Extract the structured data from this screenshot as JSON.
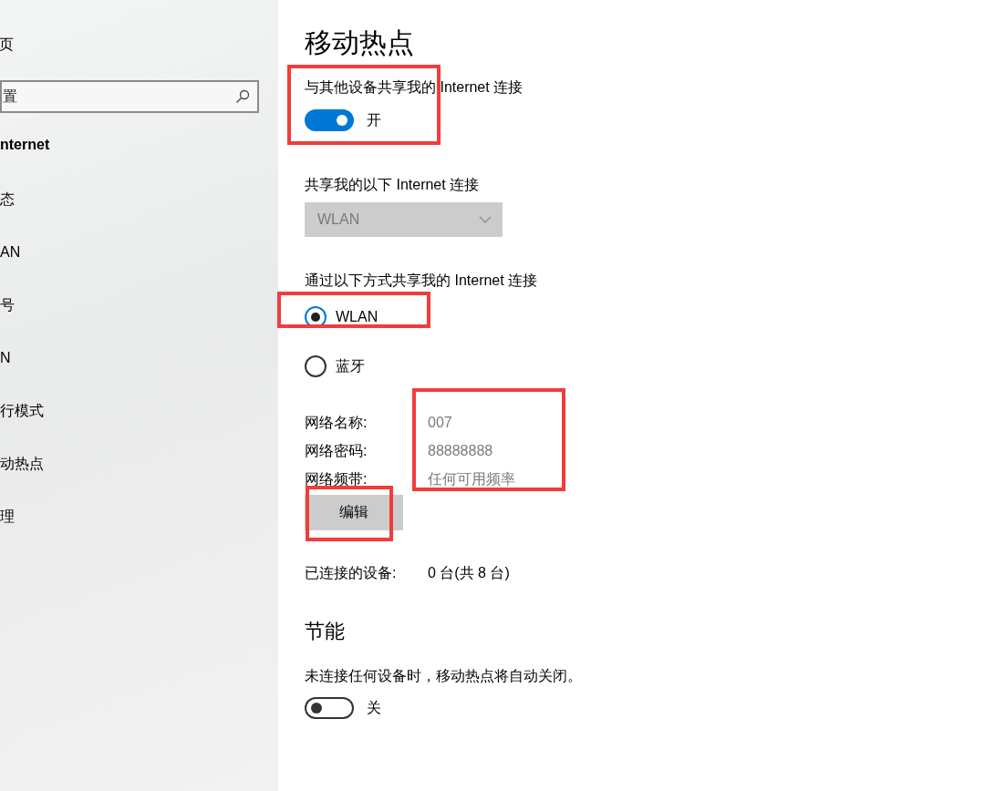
{
  "sidebar": {
    "home": "页",
    "search": {
      "placeholder": "置"
    },
    "heading": "nternet",
    "items": [
      {
        "label": "态"
      },
      {
        "label": "AN"
      },
      {
        "label": "号"
      },
      {
        "label": "N"
      },
      {
        "label": "行模式"
      },
      {
        "label": "动热点"
      },
      {
        "label": "理"
      }
    ]
  },
  "main": {
    "title": "移动热点",
    "share_toggle": {
      "label": "与其他设备共享我的 Internet 连接",
      "on": true,
      "state_text": "开",
      "highlighted": true
    },
    "share_from": {
      "label": "共享我的以下 Internet 连接",
      "value": "WLAN",
      "disabled": true
    },
    "share_via": {
      "label": "通过以下方式共享我的 Internet 连接",
      "highlighted": true,
      "options": [
        {
          "label": "WLAN",
          "selected": true
        },
        {
          "label": "蓝牙",
          "selected": false
        }
      ]
    },
    "network": {
      "highlighted": true,
      "rows": [
        {
          "label": "网络名称:",
          "value": "007"
        },
        {
          "label": "网络密码:",
          "value": "88888888"
        },
        {
          "label": "网络频带:",
          "value": "任何可用频率"
        }
      ]
    },
    "edit_button": {
      "label": "编辑",
      "highlighted": true
    },
    "connected": {
      "label": "已连接的设备:",
      "value": "0 台(共 8 台)"
    },
    "power_saving": {
      "title": "节能",
      "description": "未连接任何设备时，移动热点将自动关闭。",
      "toggle": {
        "on": false,
        "state_text": "关"
      }
    }
  }
}
